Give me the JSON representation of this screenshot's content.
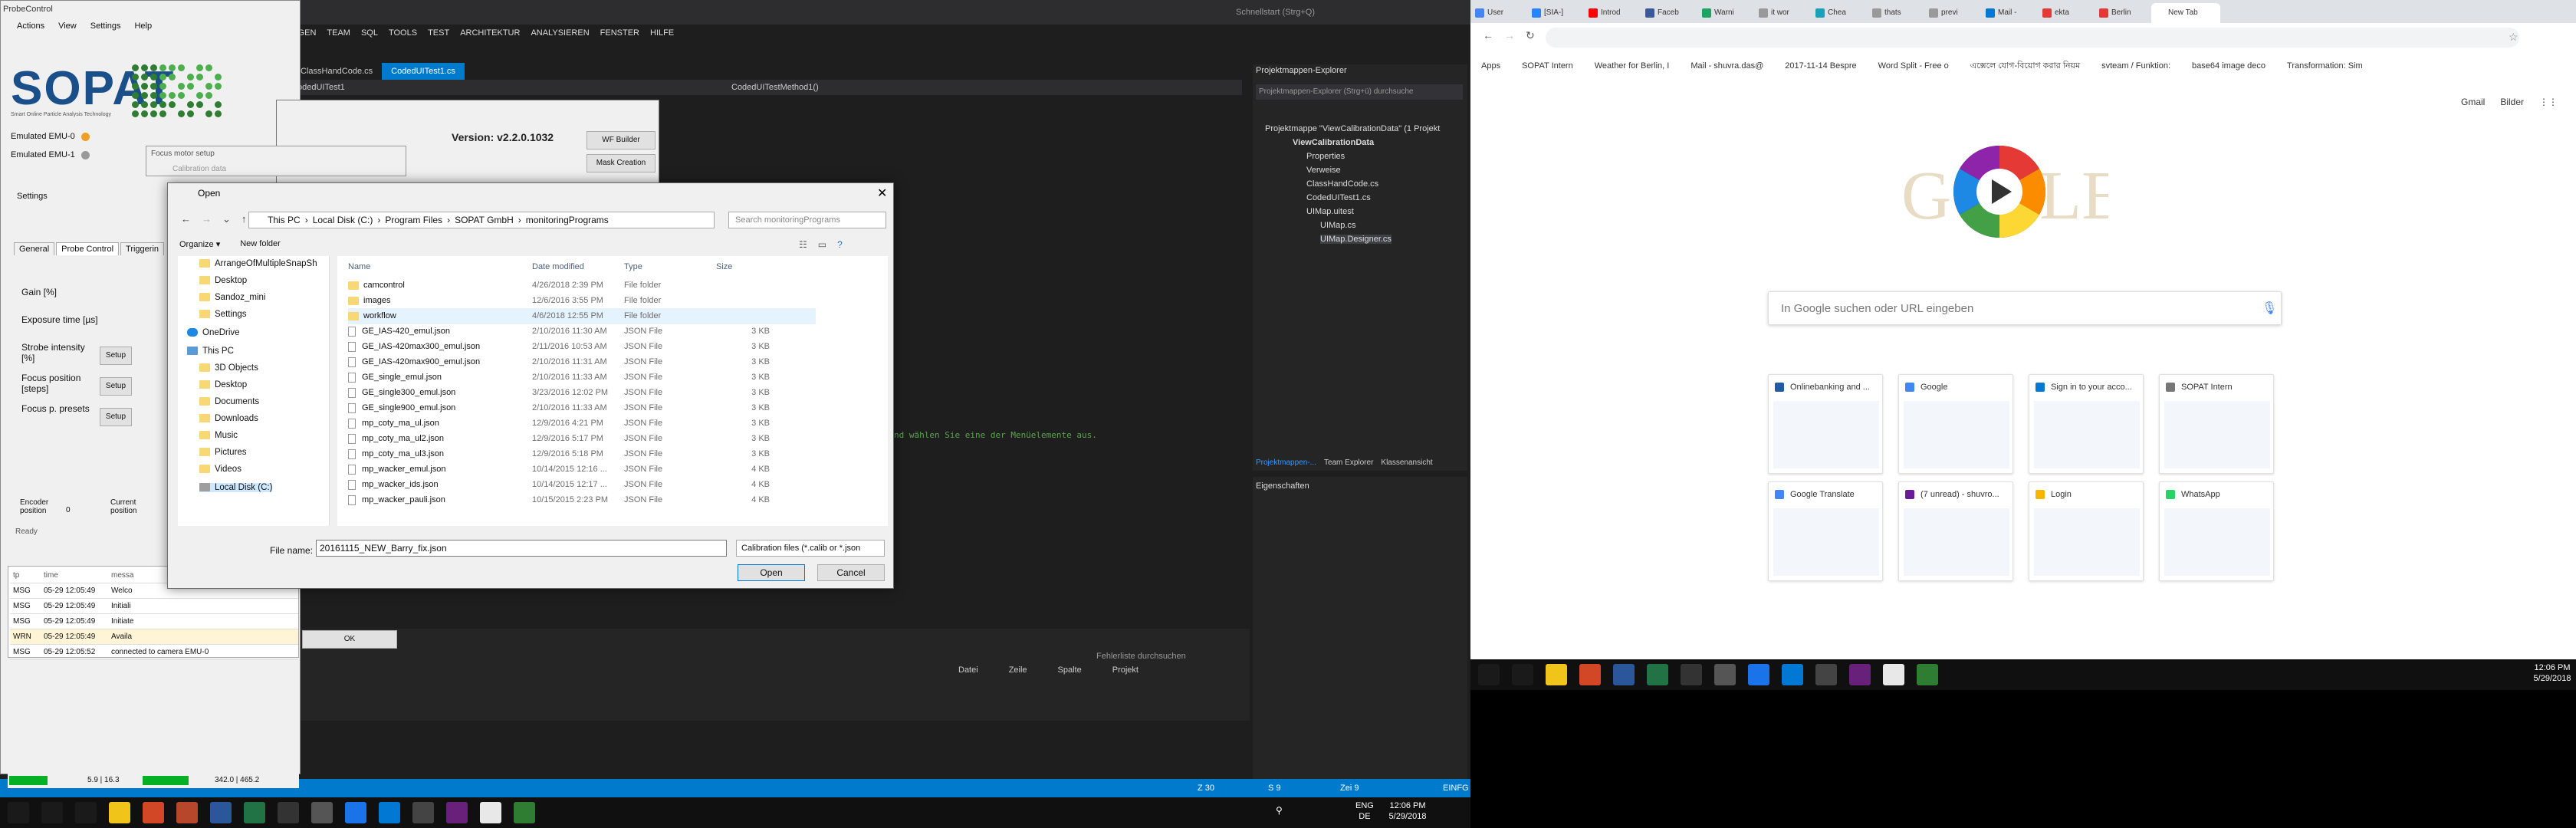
{
  "vs": {
    "search_placeholder": "Schnellstart (Strg+Q)",
    "menu": [
      "GGEN",
      "TEAM",
      "SQL",
      "TOOLS",
      "TEST",
      "ARCHITEKTUR",
      "ANALYSIEREN",
      "FENSTER",
      "HILFE"
    ],
    "tabs": [
      "ClassHandCode.cs",
      "CodedUITest1.cs"
    ],
    "nav_left": "odedUITest1",
    "nav_right": "CodedUITestMethod1()",
    "comment_text": "nd wählen Sie eine der Menüelemente aus.",
    "error_search": "Fehlerliste durchsuchen",
    "error_cols": [
      "Datei",
      "Zeile",
      "Spalte",
      "Projekt"
    ],
    "status": {
      "col": "Z 30",
      "char": "S 9",
      "zei": "Zei 9",
      "ins": "EINFG"
    },
    "solution_explorer": {
      "title": "Projektmappen-Explorer",
      "search": "Projektmappen-Explorer (Strg+ü) durchsuche",
      "items": [
        "Projektmappe \"ViewCalibrationData\" (1 Projekt",
        "ViewCalibrationData",
        "Properties",
        "Verweise",
        "ClassHandCode.cs",
        "CodedUITest1.cs",
        "UIMap.uitest",
        "UIMap.cs",
        "UIMap.Designer.cs"
      ],
      "bottom_tabs": [
        "Projektmappen-...",
        "Team Explorer",
        "Klassenansicht"
      ]
    },
    "properties_title": "Eigenschaften"
  },
  "probecontrol": {
    "title": "ProbeControl",
    "menu": [
      "Actions",
      "View",
      "Settings",
      "Help"
    ],
    "logo": "SOPAT",
    "logo_sub": "Smart Online Particle Analysis Technology",
    "version": "Version: v2.2.0.1032",
    "emulators": [
      {
        "label": "Emulated   EMU-0",
        "color": "#f0a020"
      },
      {
        "label": "Emulated   EMU-1",
        "color": "#999999"
      }
    ],
    "focus_motor": "Focus motor setup",
    "calibration_data": "Calibration data",
    "settings": "Settings",
    "tabs": [
      "General",
      "Probe Control",
      "Triggerin"
    ],
    "labels": {
      "gain": "Gain [%]",
      "exposure": "Exposure time [µs]",
      "strobe": "Strobe intensity [%]",
      "focus": "Focus position [steps]",
      "presets": "Focus p. presets",
      "encoder": "Encoder position",
      "encoder_val": "0",
      "current": "Current position",
      "ready": "Ready"
    },
    "setup": "Setup",
    "wf_builder": "WF Builder",
    "mask_creation": "Mask Creation",
    "ok": "OK",
    "log_header": [
      "tp",
      "time",
      "messa"
    ],
    "log": [
      {
        "tp": "MSG",
        "time": "05-29 12:05:49",
        "msg": "Welco"
      },
      {
        "tp": "MSG",
        "time": "05-29 12:05:49",
        "msg": "Initiali"
      },
      {
        "tp": "MSG",
        "time": "05-29 12:05:49",
        "msg": "Initiate"
      },
      {
        "tp": "WRN",
        "time": "05-29 12:05:49",
        "msg": "Availa"
      },
      {
        "tp": "MSG",
        "time": "05-29 12:05:52",
        "msg": "connected to camera EMU-0"
      }
    ],
    "bottom_vals": [
      "5.9 | 16.3",
      "342.0 | 465.2"
    ]
  },
  "open_dialog": {
    "title": "Open",
    "breadcrumbs": [
      "This PC",
      "Local Disk (C:)",
      "Program Files",
      "SOPAT GmbH",
      "monitoringPrograms"
    ],
    "search_placeholder": "Search monitoringPrograms",
    "organize": "Organize ▾",
    "new_folder": "New folder",
    "nav": [
      {
        "label": "ArrangeOfMultipleSnapSh",
        "icon": "folder"
      },
      {
        "label": "Desktop",
        "icon": "folder"
      },
      {
        "label": "Sandoz_mini",
        "icon": "folder"
      },
      {
        "label": "Settings",
        "icon": "folder"
      },
      {
        "label": "OneDrive",
        "icon": "cloud"
      },
      {
        "label": "This PC",
        "icon": "pc"
      },
      {
        "label": "3D Objects",
        "icon": "folder"
      },
      {
        "label": "Desktop",
        "icon": "folder"
      },
      {
        "label": "Documents",
        "icon": "folder"
      },
      {
        "label": "Downloads",
        "icon": "folder"
      },
      {
        "label": "Music",
        "icon": "folder"
      },
      {
        "label": "Pictures",
        "icon": "folder"
      },
      {
        "label": "Videos",
        "icon": "folder"
      },
      {
        "label": "Local Disk (C:)",
        "icon": "drive"
      }
    ],
    "columns": [
      "Name",
      "Date modified",
      "Type",
      "Size"
    ],
    "files": [
      {
        "name": "camcontrol",
        "date": "4/26/2018 2:39 PM",
        "type": "File folder",
        "size": "",
        "folder": true
      },
      {
        "name": "images",
        "date": "12/6/2016 3:55 PM",
        "type": "File folder",
        "size": "",
        "folder": true
      },
      {
        "name": "workflow",
        "date": "4/6/2018 12:55 PM",
        "type": "File folder",
        "size": "",
        "folder": true
      },
      {
        "name": "GE_IAS-420_emul.json",
        "date": "2/10/2016 11:30 AM",
        "type": "JSON File",
        "size": "3 KB",
        "folder": false
      },
      {
        "name": "GE_IAS-420max300_emul.json",
        "date": "2/11/2016 10:53 AM",
        "type": "JSON File",
        "size": "3 KB",
        "folder": false
      },
      {
        "name": "GE_IAS-420max900_emul.json",
        "date": "2/10/2016 11:31 AM",
        "type": "JSON File",
        "size": "3 KB",
        "folder": false
      },
      {
        "name": "GE_single_emul.json",
        "date": "2/10/2016 11:33 AM",
        "type": "JSON File",
        "size": "3 KB",
        "folder": false
      },
      {
        "name": "GE_single300_emul.json",
        "date": "3/23/2016 12:02 PM",
        "type": "JSON File",
        "size": "3 KB",
        "folder": false
      },
      {
        "name": "GE_single900_emul.json",
        "date": "2/10/2016 11:33 AM",
        "type": "JSON File",
        "size": "3 KB",
        "folder": false
      },
      {
        "name": "mp_coty_ma_ul.json",
        "date": "12/9/2016 4:21 PM",
        "type": "JSON File",
        "size": "3 KB",
        "folder": false
      },
      {
        "name": "mp_coty_ma_ul2.json",
        "date": "12/9/2016 5:17 PM",
        "type": "JSON File",
        "size": "3 KB",
        "folder": false
      },
      {
        "name": "mp_coty_ma_ul3.json",
        "date": "12/9/2016 5:18 PM",
        "type": "JSON File",
        "size": "3 KB",
        "folder": false
      },
      {
        "name": "mp_wacker_emul.json",
        "date": "10/14/2015 12:16 ...",
        "type": "JSON File",
        "size": "4 KB",
        "folder": false
      },
      {
        "name": "mp_wacker_ids.json",
        "date": "10/14/2015 12:17 ...",
        "type": "JSON File",
        "size": "4 KB",
        "folder": false
      },
      {
        "name": "mp_wacker_pauli.json",
        "date": "10/15/2015 2:23 PM",
        "type": "JSON File",
        "size": "4 KB",
        "folder": false
      }
    ],
    "file_name_label": "File name:",
    "file_name_value": "20161115_NEW_Barry_fix.json",
    "file_type": "Calibration files (*.calib or *.json",
    "open_btn": "Open",
    "cancel_btn": "Cancel"
  },
  "chrome": {
    "tabs": [
      {
        "label": "User",
        "color": "#4285f4"
      },
      {
        "label": "[SIA-]",
        "color": "#2684ff"
      },
      {
        "label": "Introd",
        "color": "#ff0000"
      },
      {
        "label": "Faceb",
        "color": "#3b5998"
      },
      {
        "label": "Warni",
        "color": "#1da462"
      },
      {
        "label": "it wor",
        "color": "#999999"
      },
      {
        "label": "Chea",
        "color": "#17a2b8"
      },
      {
        "label": "thats",
        "color": "#999999"
      },
      {
        "label": "previ",
        "color": "#999999"
      },
      {
        "label": "Mail -",
        "color": "#0078d4"
      },
      {
        "label": "ekta",
        "color": "#e53935"
      },
      {
        "label": "Berlin",
        "color": "#e53935"
      },
      {
        "label": "New Tab",
        "color": "#ffffff"
      }
    ],
    "bookmarks": [
      "Apps",
      "SOPAT Intern",
      "Weather for Berlin, I",
      "Mail - shuvra.das@",
      "2017-11-14 Bespre",
      "Word Split - Free o",
      "এক্সেলে যোগ-বিয়োগ করার নিয়ম",
      "svteam / Funktion:",
      "base64 image deco",
      "Transformation: Sim"
    ],
    "links": [
      "Gmail",
      "Bilder"
    ],
    "search_placeholder": "In Google suchen oder URL eingeben",
    "tiles": [
      {
        "title": "Onlinebanking and ...",
        "color": "#1e5ba8"
      },
      {
        "title": "Google",
        "color": "#4285f4"
      },
      {
        "title": "Sign in to your acco...",
        "color": "#0078d4"
      },
      {
        "title": "SOPAT Intern",
        "color": "#777777"
      },
      {
        "title": "Google Translate",
        "color": "#4285f4"
      },
      {
        "title": "(7 unread) - shuvro...",
        "color": "#6a1b9a"
      },
      {
        "title": "Login",
        "color": "#f7b500"
      },
      {
        "title": "WhatsApp",
        "color": "#25d366"
      }
    ]
  },
  "taskbar": {
    "time1": "12:06 PM",
    "date1": "5/29/2018",
    "lang": "ENG",
    "lang2": "DE",
    "time2": "12:06 PM",
    "date2": "5/29/2018"
  }
}
